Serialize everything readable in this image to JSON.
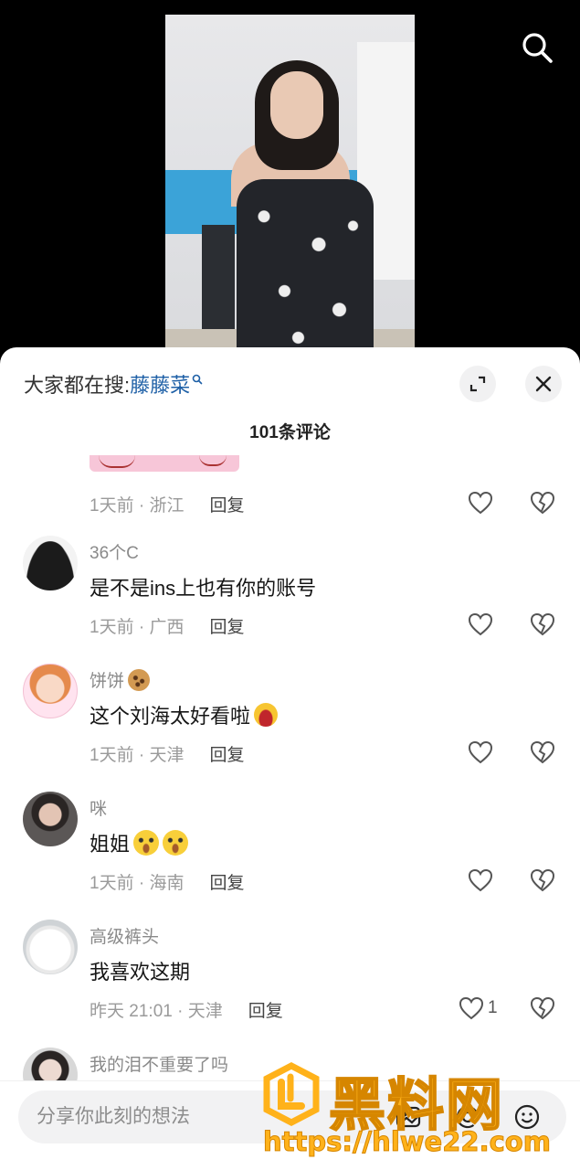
{
  "video": {
    "search_icon": "search-icon"
  },
  "header": {
    "trending_prefix": "大家都在搜:",
    "trending_term": "藤藤菜",
    "comment_count": "101条评论",
    "expand_icon": "expand-icon",
    "close_icon": "close-icon"
  },
  "comments": [
    {
      "username": "",
      "text": "",
      "time_location": "1天前 · 浙江",
      "reply": "回复",
      "likes": ""
    },
    {
      "username": "36个C",
      "text": "是不是ins上也有你的账号",
      "time_location": "1天前 · 广西",
      "reply": "回复",
      "likes": ""
    },
    {
      "username": "饼饼",
      "username_emoji": "cookie-emoji",
      "text": "这个刘海太好看啦",
      "text_emoji": "laughing-emoji",
      "time_location": "1天前 · 天津",
      "reply": "回复",
      "likes": ""
    },
    {
      "username": "咪",
      "text": "姐姐",
      "text_emoji": "shy-face-emoji",
      "time_location": "1天前 · 海南",
      "reply": "回复",
      "likes": ""
    },
    {
      "username": "高级裤头",
      "text": "我喜欢这期",
      "time_location": "昨天 21:01 · 天津",
      "reply": "回复",
      "likes": "1"
    },
    {
      "username": "我的泪不重要了吗",
      "text": "",
      "time_location": "",
      "reply": "",
      "likes": ""
    }
  ],
  "input": {
    "placeholder": "分享你此刻的想法"
  },
  "watermark": {
    "brand": "黑料网",
    "url": "https://hlwe22.com"
  },
  "colors": {
    "accent_link": "#1d5fa6",
    "watermark": "#ffb21a"
  }
}
